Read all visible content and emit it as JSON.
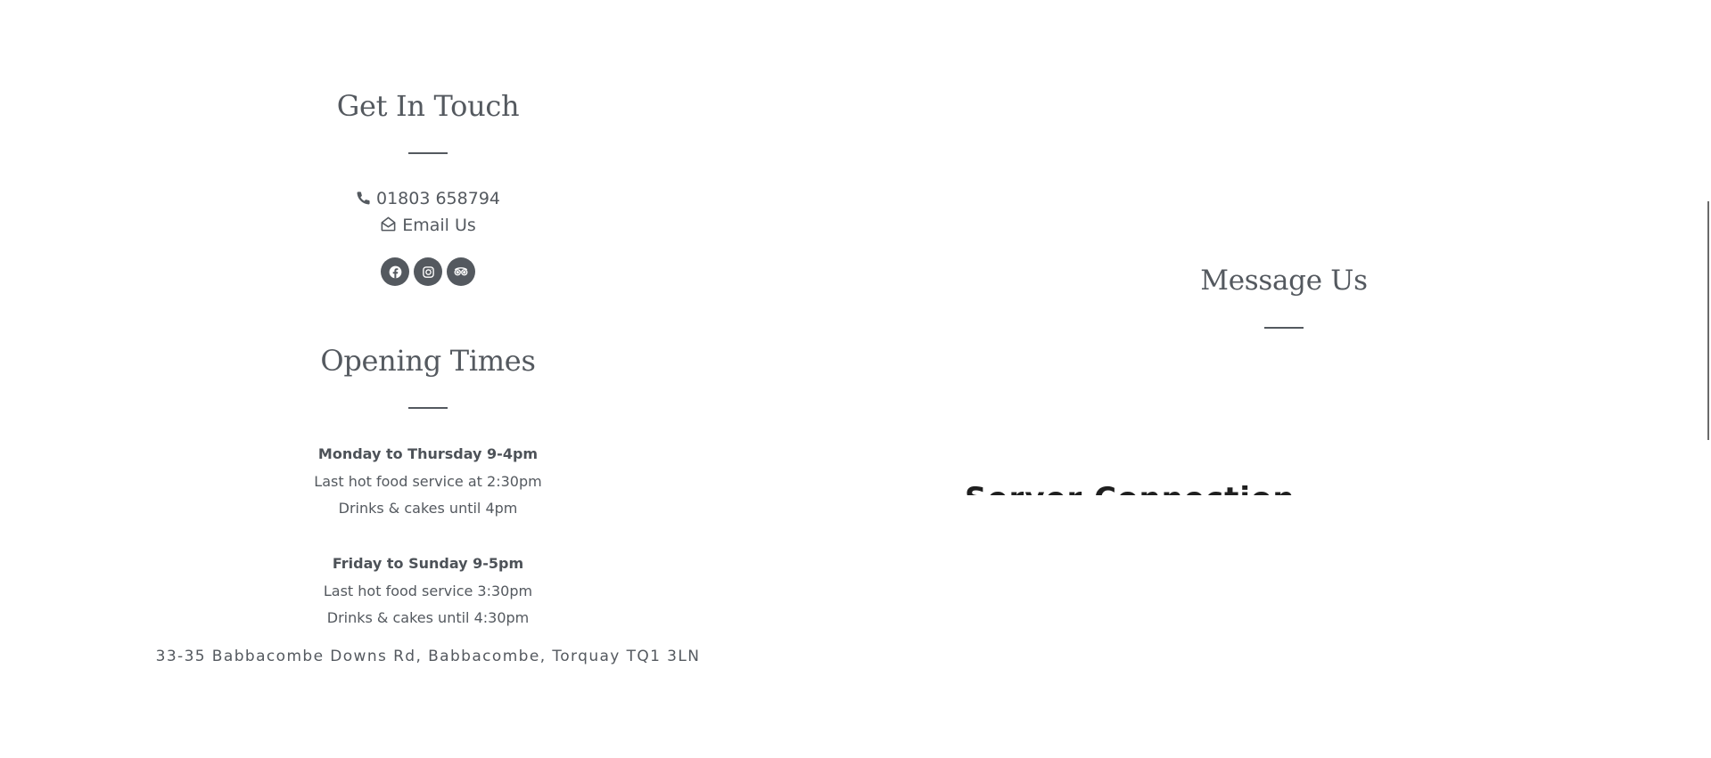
{
  "contact": {
    "heading": "Get In Touch",
    "phone": "01803 658794",
    "email_label": "Email Us",
    "social": [
      {
        "name": "facebook-icon"
      },
      {
        "name": "instagram-icon"
      },
      {
        "name": "tripadvisor-icon"
      }
    ]
  },
  "opening": {
    "heading": "Opening Times",
    "blocks": [
      {
        "title": "Monday to Thursday 9-4pm",
        "line1": "Last hot food service at 2:30pm",
        "line2": "Drinks & cakes until 4pm"
      },
      {
        "title": "Friday to Sunday 9-5pm",
        "line1": "Last hot food service 3:30pm",
        "line2": "Drinks & cakes until 4:30pm"
      }
    ]
  },
  "address": "33-35 Babbacombe Downs Rd, Babbacombe, Torquay TQ1 3LN",
  "message": {
    "heading": "Message Us",
    "clipped_text": "Server Connection Failed"
  },
  "colors": {
    "text": "#54595f",
    "icon_bg": "#54595f",
    "background": "#ffffff"
  }
}
